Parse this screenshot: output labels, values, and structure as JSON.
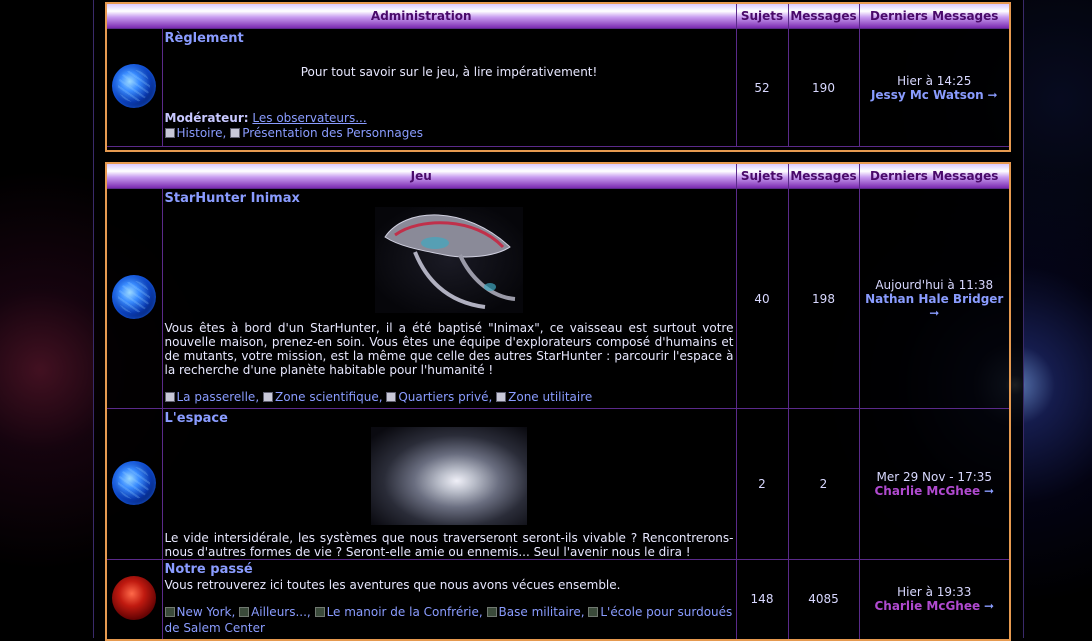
{
  "header": {
    "cat1": "Administration",
    "cat2": "Jeu",
    "subjects": "Sujets",
    "messages": "Messages",
    "last": "Derniers Messages"
  },
  "forums": [
    {
      "title": "Règlement",
      "description": "Pour tout savoir sur le jeu, à lire impérativement!",
      "moderator_label": "Modérateur:",
      "moderator": "Les observateurs...",
      "subforums": [
        "Histoire",
        "Présentation des Personnages"
      ],
      "subjects": "52",
      "messages": "190",
      "last_date": "Hier à 14:25",
      "last_user": "Jessy Mc Watson",
      "icon": "blue-globe-icon"
    },
    {
      "title": "StarHunter Inimax",
      "description": "Vous êtes à bord d'un StarHunter, il a été baptisé \"Inimax\", ce vaisseau est surtout votre nouvelle maison, prenez-en soin. Vous êtes une équipe d'explorateurs composé d'humains et de mutants, votre mission, est la même que celle des autres StarHunter : parcourir l'espace à la recherche d'une planète habitable pour l'humanité !",
      "subforums": [
        "La passerelle",
        "Zone scientifique",
        "Quartiers privé",
        "Zone utilitaire"
      ],
      "subjects": "40",
      "messages": "198",
      "last_date": "Aujourd'hui à 11:38",
      "last_user": "Nathan Hale Bridger",
      "icon": "blue-globe-icon"
    },
    {
      "title": "L'espace",
      "description": "Le vide intersidérale, les systèmes que nous traverseront seront-ils vivable ? Rencontrerons-nous d'autres formes de vie ? Seront-elle amie ou ennemis... Seul l'avenir nous le dira !",
      "subjects": "2",
      "messages": "2",
      "last_date": "Mer 29 Nov - 17:35",
      "last_user": "Charlie McGhee",
      "icon": "blue-globe-icon"
    },
    {
      "title": "Notre passé",
      "description": "Vous retrouverez ici toutes les aventures que nous avons vécues ensemble.",
      "subforums": [
        "New York",
        "Ailleurs...",
        "Le manoir de la Confrérie",
        "Base militaire",
        "L'école pour surdoués de Salem Center"
      ],
      "subjects": "148",
      "messages": "4085",
      "last_date": "Hier à 19:33",
      "last_user": "Charlie McGhee",
      "icon": "red-planet-icon"
    }
  ]
}
